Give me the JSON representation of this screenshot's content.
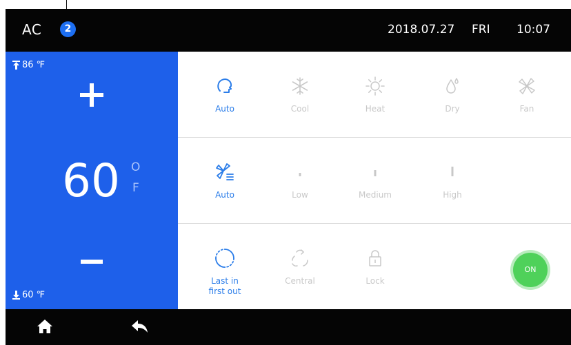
{
  "status_bar": {
    "title": "AC",
    "badge_count": "2",
    "date": "2018.07.27",
    "day": "FRI",
    "time": "10:07"
  },
  "temperature": {
    "max_label": "86 ℉",
    "min_label": "60 ℉",
    "value": "60",
    "unit_top": "O",
    "unit_bottom": "F"
  },
  "mode_options": [
    {
      "label": "Auto",
      "icon": "auto-mode-icon",
      "active": true
    },
    {
      "label": "Cool",
      "icon": "snowflake-icon",
      "active": false
    },
    {
      "label": "Heat",
      "icon": "sun-icon",
      "active": false
    },
    {
      "label": "Dry",
      "icon": "droplet-icon",
      "active": false
    },
    {
      "label": "Fan",
      "icon": "fan-icon",
      "active": false
    }
  ],
  "fan_speed_options": [
    {
      "label": "Auto",
      "icon": "fan-auto-icon",
      "active": true
    },
    {
      "label": "Low",
      "icon": "speed-bar-low-icon",
      "active": false
    },
    {
      "label": "Medium",
      "icon": "speed-bar-medium-icon",
      "active": false
    },
    {
      "label": "High",
      "icon": "speed-bar-high-icon",
      "active": false
    }
  ],
  "extra_options": [
    {
      "label_line1": "Last in",
      "label_line2": "first out",
      "icon": "cycle-icon",
      "active": true
    },
    {
      "label_line1": "Central",
      "label_line2": "",
      "icon": "central-icon",
      "active": false
    },
    {
      "label_line1": "Lock",
      "label_line2": "",
      "icon": "lock-icon",
      "active": false
    }
  ],
  "power": {
    "label": "ON",
    "state": "on"
  },
  "nav": {
    "home_icon": "home-icon",
    "back_icon": "back-icon"
  },
  "colors": {
    "accent": "#1e60ea",
    "active_text": "#2b7de9",
    "inactive_text": "#c8c8c8",
    "power_on": "#4fd15a",
    "bar_bg": "#050505"
  }
}
